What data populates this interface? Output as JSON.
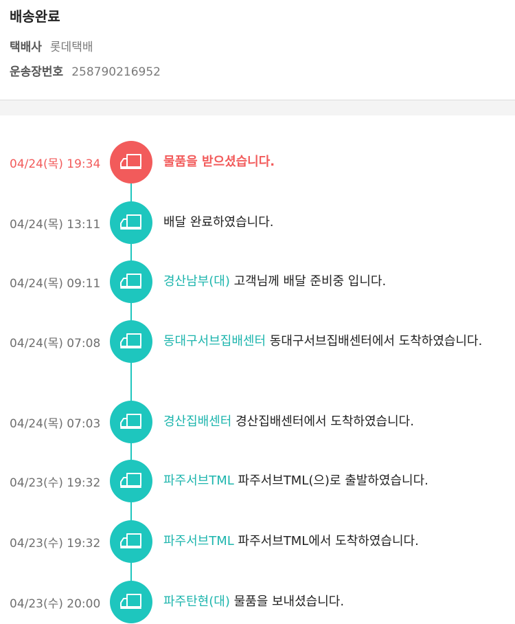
{
  "header": {
    "status": "배송완료",
    "courier_label": "택배사",
    "courier_value": "롯데택배",
    "tracking_label": "운송장번호",
    "tracking_value": "258790216952"
  },
  "colors": {
    "accent": "#1ec6be",
    "latest": "#f25b5b"
  },
  "icon": "truck-icon",
  "events": [
    {
      "time": "04/24(목) 19:34",
      "location": "",
      "message": "물품을 받으셨습니다."
    },
    {
      "time": "04/24(목) 13:11",
      "location": "",
      "message": "배달 완료하였습니다."
    },
    {
      "time": "04/24(목) 09:11",
      "location": "경산남부(대)",
      "message": "고객님께 배달 준비중 입니다."
    },
    {
      "time": "04/24(목) 07:08",
      "location": "동대구서브집배센터",
      "message": "동대구서브집배센터에서 도착하였습니다."
    },
    {
      "time": "04/24(목) 07:03",
      "location": "경산집배센터",
      "message": "경산집배센터에서 도착하였습니다."
    },
    {
      "time": "04/23(수) 19:32",
      "location": "파주서브TML",
      "message": "파주서브TML(으)로 출발하였습니다."
    },
    {
      "time": "04/23(수) 19:32",
      "location": "파주서브TML",
      "message": "파주서브TML에서 도착하였습니다."
    },
    {
      "time": "04/23(수) 20:00",
      "location": "파주탄현(대)",
      "message": "물품을 보내셨습니다."
    }
  ]
}
